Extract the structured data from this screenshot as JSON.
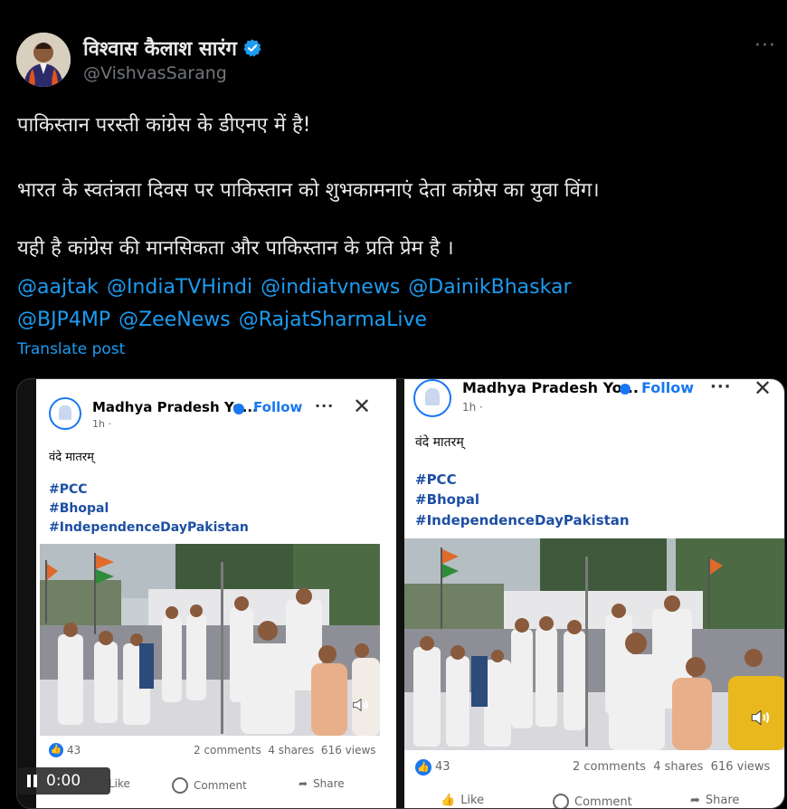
{
  "author": {
    "display_name": "विश्वास कैलाश सारंग",
    "handle": "@VishvasSarang"
  },
  "post": {
    "line1": "पाकिस्तान परस्ती कांग्रेस के डीएनए में है!",
    "line2": "भारत के स्वतंत्रता दिवस पर पाकिस्तान को शुभकामनाएं देता कांग्रेस का युवा विंग।",
    "line3": "यही है कांग्रेस की मानसिकता और पाकिस्तान के प्रति प्रेम है ।",
    "mentions_row1": [
      "@aajtak",
      "@IndiaTVHindi",
      "@indiatvnews",
      "@DainikBhaskar"
    ],
    "mentions_row2": [
      "@BJP4MP",
      "@ZeeNews",
      "@RajatSharmaLive"
    ],
    "translate": "Translate post"
  },
  "embed": {
    "page_name_left": "Madhya Pradesh Yo...",
    "page_name_right": "Madhya Pradesh Yo...",
    "follow": "Follow",
    "time": "1h ·",
    "caption": "वंदे मातरम्",
    "hashtags": [
      "#PCC",
      "#Bhopal",
      "#IndependenceDayPakistan"
    ],
    "reactions": "43",
    "stats": "2 comments  4 shares  616 views",
    "like": "Like",
    "comment": "Comment",
    "share": "Share"
  },
  "player": {
    "time": "0:00"
  },
  "colors": {
    "background": "#000000",
    "link": "#1d9bf0",
    "facebook_blue": "#1877f2"
  }
}
